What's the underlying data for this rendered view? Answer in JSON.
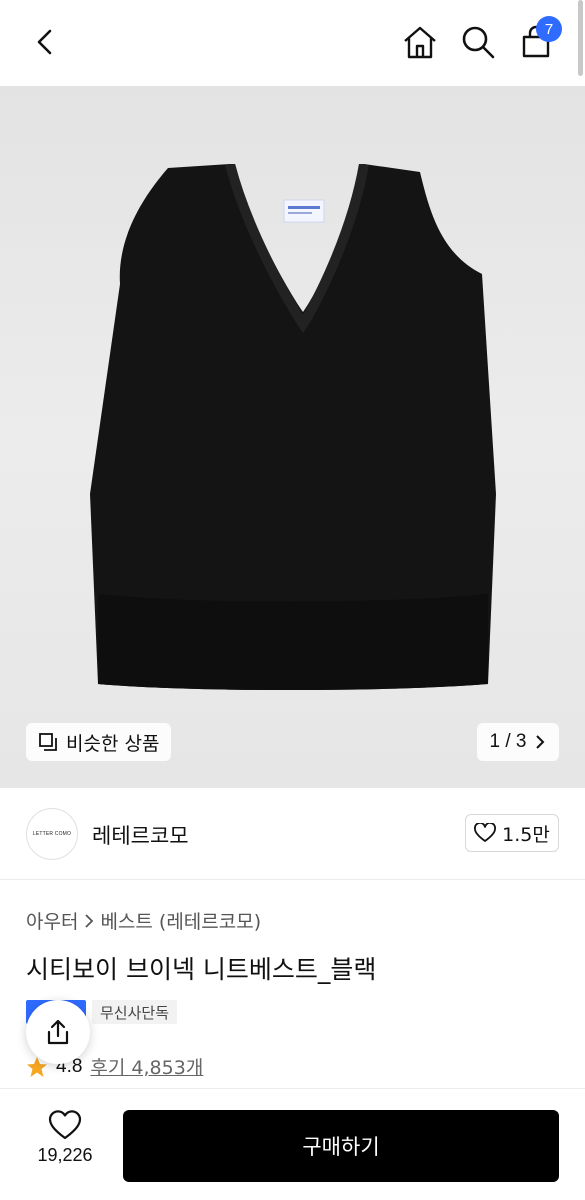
{
  "header": {
    "cart_count": "7"
  },
  "gallery": {
    "similar_label": "비슷한 상품",
    "pager": "1 / 3"
  },
  "brand": {
    "logo_text": "LETTER COMO",
    "name": "레테르코모",
    "likes": "1.5만"
  },
  "product": {
    "breadcrumb": [
      "아우터",
      "베스트",
      "(레테르코모)"
    ],
    "title": "시티보이 브이넥 니트베스트_블랙",
    "badge_exclusive": "무신사단독",
    "rating": "4.8",
    "reviews": "후기 4,853개"
  },
  "bottom": {
    "wish_count": "19,226",
    "buy_label": "구매하기"
  },
  "colors": {
    "accent": "#2f6bff",
    "star": "#f5a623",
    "buy_button": "#000000"
  },
  "icons": [
    "back-icon",
    "home-icon",
    "search-icon",
    "cart-icon",
    "copy-icon",
    "chevron-right-icon",
    "heart-icon",
    "share-icon",
    "star-icon"
  ]
}
